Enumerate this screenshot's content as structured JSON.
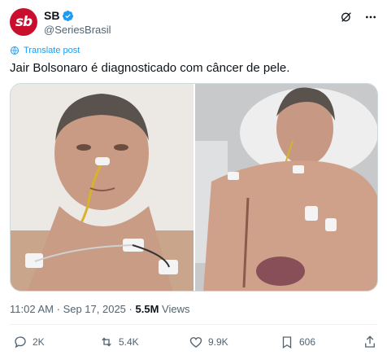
{
  "header": {
    "display_name": "SB",
    "handle": "@SeriesBrasil",
    "avatar_text": "sb",
    "avatar_color": "#c8102e",
    "verified_color": "#1d9bf0"
  },
  "translate_label": "Translate post",
  "tweet_text": "Jair Bolsonaro é diagnosticado com câncer de pele.",
  "meta": {
    "time": "11:02 AM",
    "separator1": "·",
    "date": "Sep 17, 2025",
    "separator2": "·",
    "views_count": "5.5M",
    "views_label": "Views"
  },
  "actions": {
    "reply_count": "2K",
    "retweet_count": "5.4K",
    "like_count": "9.9K",
    "bookmark_count": "606"
  },
  "icons": [
    "grok-icon",
    "more-icon",
    "translate-icon",
    "reply-icon",
    "retweet-icon",
    "like-icon",
    "bookmark-icon",
    "share-icon"
  ]
}
